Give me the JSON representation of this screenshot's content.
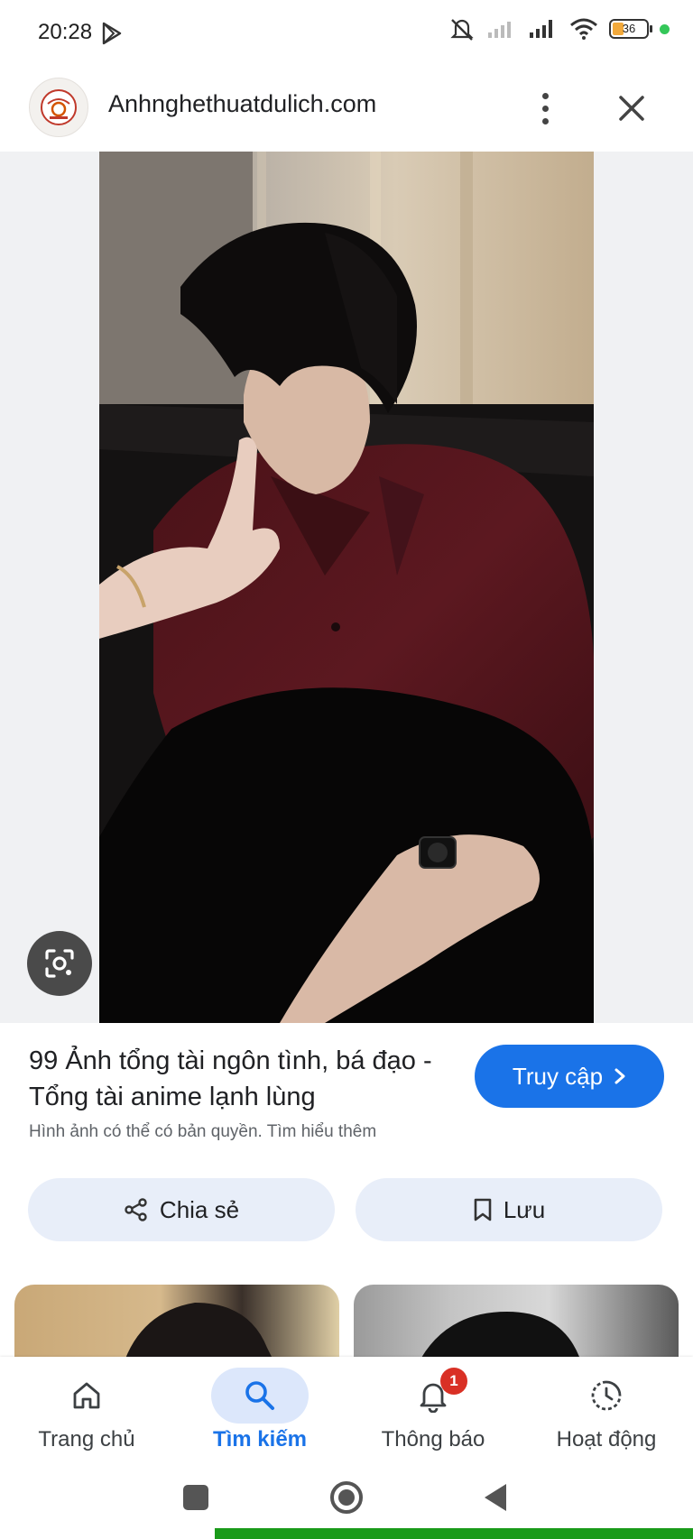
{
  "status_bar": {
    "time": "20:28",
    "battery_level": "36",
    "icons": [
      "play-store-icon",
      "mute-icon",
      "signal-icon",
      "wifi-icon",
      "battery-icon"
    ]
  },
  "url_bar": {
    "site_title": "Anhnghethuatdulich.com",
    "more_icon": "more-vert-icon",
    "close_icon": "close-icon"
  },
  "image_viewer": {
    "lens_icon": "google-lens-icon"
  },
  "result": {
    "title": "99 Ảnh tổng tài ngôn tình, bá đạo - Tổng tài anime lạnh lùng",
    "visit_label": "Truy cập",
    "copyright_note": "Hình ảnh có thể có bản quyền. Tìm hiểu thêm",
    "share_label": "Chia sẻ",
    "save_label": "Lưu"
  },
  "bottom_nav": {
    "items": [
      {
        "label": "Trang chủ",
        "icon": "home-icon",
        "active": false
      },
      {
        "label": "Tìm kiếm",
        "icon": "search-icon",
        "active": true
      },
      {
        "label": "Thông báo",
        "icon": "bell-icon",
        "active": false,
        "badge": "1"
      },
      {
        "label": "Hoạt động",
        "icon": "activity-icon",
        "active": false
      }
    ]
  },
  "colors": {
    "accent": "#1a73e8",
    "chip_bg": "#e8eef9",
    "badge": "#d93025"
  }
}
